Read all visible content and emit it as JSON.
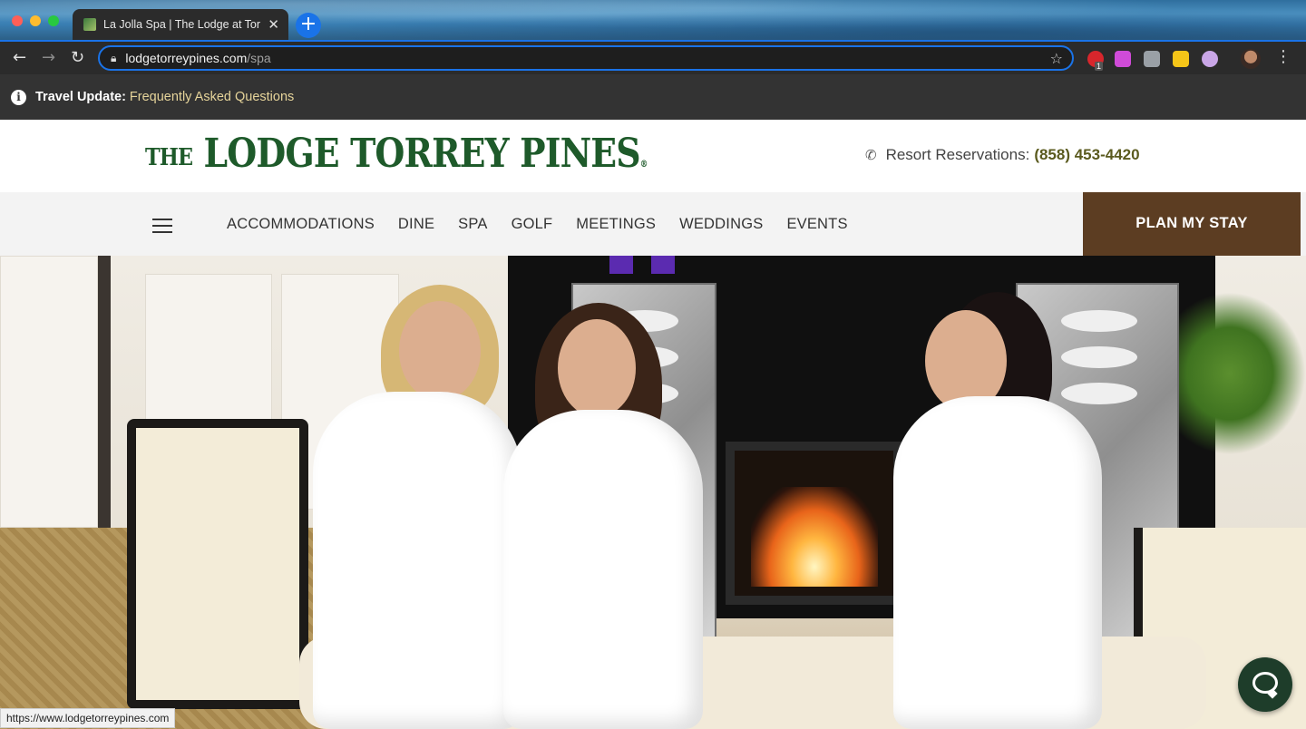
{
  "browser": {
    "tab_title": "La Jolla Spa | The Lodge at Tor",
    "tab_close": "✕",
    "new_tab": "+",
    "url_host": "lodgetorreypines.com",
    "url_path": "/spa",
    "ext_badge": "1",
    "status_url": "https://www.lodgetorreypines.com",
    "icons": {
      "back": "arrow-left-icon",
      "forward": "arrow-right-icon",
      "reload": "reload-icon",
      "lock": "lock-icon",
      "bookmark": "star-icon",
      "menu": "kebab-menu-icon"
    }
  },
  "travel_update": {
    "label": "Travel Update:",
    "link": "Frequently Asked Questions",
    "icon": "info-icon",
    "link_color": "#e6d49a"
  },
  "header": {
    "logo_the": "THE",
    "logo_main": "LODGE TORREY PINES",
    "logo_reg": "®",
    "reservations_label": "Resort Reservations:",
    "reservations_phone": "(858) 453-4420",
    "brand_color": "#1e5a2a"
  },
  "nav": {
    "items": [
      "ACCOMMODATIONS",
      "DINE",
      "SPA",
      "GOLF",
      "MEETINGS",
      "WEDDINGS",
      "EVENTS"
    ],
    "cta": "PLAN MY STAY",
    "cta_color": "#5c3d22"
  }
}
